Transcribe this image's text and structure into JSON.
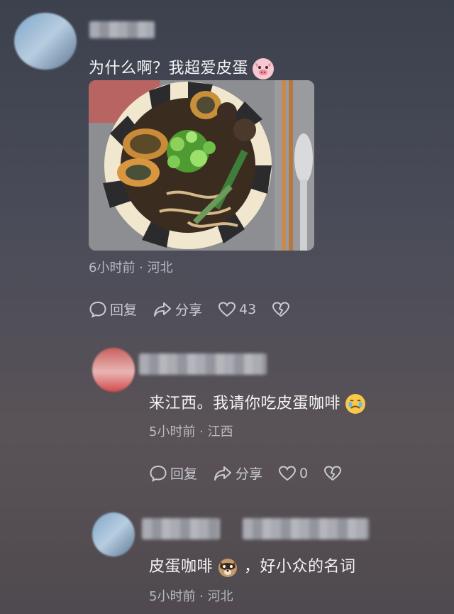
{
  "comments": [
    {
      "text": "为什么啊？我超爱皮蛋",
      "meta": "6小时前 · 河北",
      "reply": "回复",
      "share": "分享",
      "likes": "43"
    },
    {
      "text": "来江西。我请你吃皮蛋咖啡",
      "meta": "5小时前 · 江西",
      "reply": "回复",
      "share": "分享",
      "likes": "0"
    },
    {
      "text_a": "皮蛋咖啡",
      "text_b": "，好小众的名词",
      "meta": "5小时前 · 河北"
    }
  ],
  "colors": {
    "background": "#484a55",
    "meta": "#b9bbc2",
    "text": "#f4f4f4"
  },
  "icons": [
    "reply-bubble-icon",
    "share-arrow-icon",
    "heart-icon",
    "broken-heart-icon",
    "pig-emoji",
    "crying-emoji",
    "raccoon-emoji"
  ]
}
